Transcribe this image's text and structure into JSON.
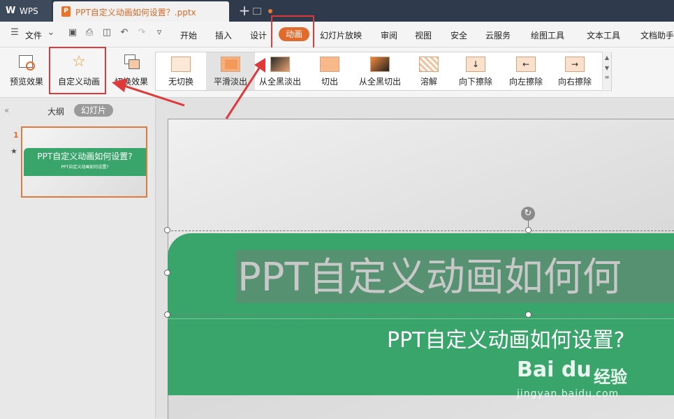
{
  "tabs": {
    "app_label": "WPS",
    "doc_title": "PPT自定义动画如何设置？.pptx",
    "new_tab": "+"
  },
  "menu": {
    "file": "文件",
    "items": [
      "开始",
      "插入",
      "设计",
      "动画",
      "幻灯片放映",
      "审阅",
      "视图",
      "安全",
      "云服务",
      "绘图工具",
      "文本工具",
      "文档助手"
    ],
    "active": "动画"
  },
  "ribbon": {
    "preview": "预览效果",
    "custom_anim": "自定义动画",
    "switch_effect": "切换效果",
    "gallery": [
      "无切换",
      "平滑淡出",
      "从全黑淡出",
      "切出",
      "从全黑切出",
      "溶解",
      "向下擦除",
      "向左擦除",
      "向右擦除"
    ],
    "selected": "平滑淡出"
  },
  "left_panel": {
    "collapse": "«",
    "tab_outline": "大纲",
    "tab_slides": "幻灯片",
    "slide_number": "1",
    "thumb_title": "PPT自定义动画如何设置?",
    "thumb_sub": "PPT自定义动画如何设置?"
  },
  "slide": {
    "title": "PPT自定义动画如何何",
    "subtitle": "PPT自定义动画如何设置?"
  },
  "watermark": {
    "brand": "Bai du",
    "cn": "经验",
    "url": "jingyan.baidu.com"
  },
  "colors": {
    "accent": "#e06b2c",
    "green": "#3aa56b",
    "highlight_box": "#e0393a"
  }
}
